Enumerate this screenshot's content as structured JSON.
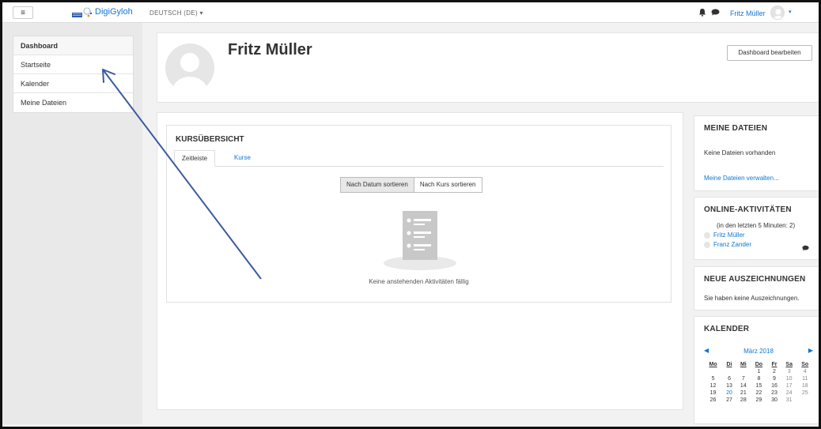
{
  "navbar": {
    "menu_icon": "hamburger-icon",
    "site_name": "DigiGyloh",
    "language": "DEUTSCH (DE) ▾",
    "user_name": "Fritz Müller",
    "user_caret": "▾",
    "bell_icon": "bell-icon",
    "chat_icon": "chat-icon"
  },
  "sidebar": {
    "items": [
      {
        "label": "Dashboard"
      },
      {
        "label": "Startseite"
      },
      {
        "label": "Kalender"
      },
      {
        "label": "Meine Dateien"
      }
    ]
  },
  "header": {
    "title": "Fritz Müller",
    "edit_button": "Dashboard bearbeiten"
  },
  "course_overview": {
    "title": "KURSÜBERSICHT",
    "tabs": [
      {
        "label": "Zeitleiste"
      },
      {
        "label": "Kurse"
      }
    ],
    "sort_buttons": [
      {
        "label": "Nach Datum sortieren"
      },
      {
        "label": "Nach Kurs sortieren"
      }
    ],
    "empty_message": "Keine anstehenden Aktivitäten fällig"
  },
  "files_block": {
    "title": "MEINE DATEIEN",
    "text": "Keine Dateien vorhanden",
    "link": "Meine Dateien verwalten..."
  },
  "online_block": {
    "title": "ONLINE-AKTIVITÄTEN",
    "subtitle": "(in den letzten 5 Minuten: 2)",
    "users": [
      {
        "name": "Fritz Müller"
      },
      {
        "name": "Franz Zander"
      }
    ]
  },
  "badges_block": {
    "title": "NEUE AUSZEICHNUNGEN",
    "text": "Sie haben keine Auszeichnungen."
  },
  "calendar_block": {
    "title": "KALENDER",
    "month": "März 2018",
    "prev": "◀",
    "next": "▶",
    "weekdays": [
      "Mo",
      "Di",
      "Mi",
      "Do",
      "Fr",
      "Sa",
      "So"
    ],
    "weeks": [
      [
        "",
        "",
        "",
        "1",
        "2",
        "3",
        "4"
      ],
      [
        "5",
        "6",
        "7",
        "8",
        "9",
        "10",
        "11"
      ],
      [
        "12",
        "13",
        "14",
        "15",
        "16",
        "17",
        "18"
      ],
      [
        "19",
        "20",
        "21",
        "22",
        "23",
        "24",
        "25"
      ],
      [
        "26",
        "27",
        "28",
        "29",
        "30",
        "31",
        ""
      ]
    ],
    "today": "20"
  },
  "colors": {
    "accent": "#1177d1",
    "annotation_arrow": "#3b5aa0"
  }
}
